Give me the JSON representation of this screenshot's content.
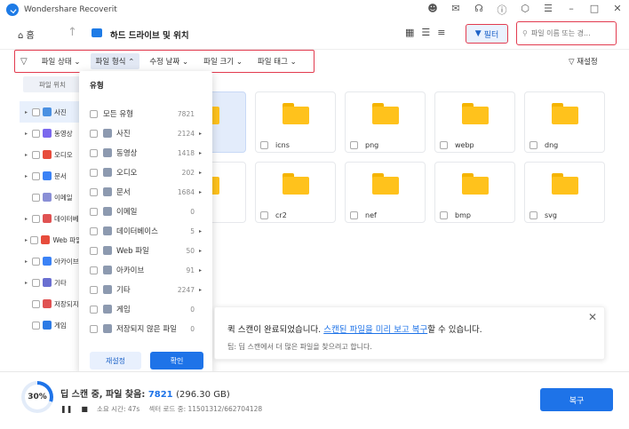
{
  "app": {
    "title": "Wondershare Recoverit"
  },
  "titlebar_icons": [
    "user-icon",
    "mail-icon",
    "headset-icon",
    "info-icon",
    "box-icon",
    "menu-icon",
    "minimize-icon",
    "maximize-icon",
    "close-icon"
  ],
  "nav": {
    "home": "홈",
    "drive_title": "하드 드라이브 및 위치",
    "filter_label": "필터",
    "search_placeholder": "파일 이름 또는 경..."
  },
  "filterbar": {
    "items": [
      "파일 상태",
      "파일 형식",
      "수정 날짜",
      "파일 크기",
      "파일 태그"
    ],
    "active_index": 1,
    "reset_label": "재설정"
  },
  "sidebar": {
    "header": "파일 위치",
    "items": [
      {
        "label": "사진",
        "color": "#4a90e2",
        "selected": true
      },
      {
        "label": "동영상",
        "color": "#7b68ee"
      },
      {
        "label": "오디오",
        "color": "#e74c3c"
      },
      {
        "label": "문서",
        "color": "#3b82f6"
      },
      {
        "label": "이메일",
        "color": "#8a8fd6"
      },
      {
        "label": "데이터베",
        "color": "#e05252"
      },
      {
        "label": "Web 파일",
        "color": "#e74c3c"
      },
      {
        "label": "아카이브",
        "color": "#3b82f6"
      },
      {
        "label": "기타",
        "color": "#6a6fd1"
      },
      {
        "label": "저장되지",
        "color": "#e05252"
      },
      {
        "label": "게임",
        "color": "#2d7be5"
      }
    ]
  },
  "dropdown": {
    "title": "유형",
    "rows": [
      {
        "label": "모든 유형",
        "count": "7821"
      },
      {
        "label": "사진",
        "count": "2124"
      },
      {
        "label": "동영상",
        "count": "1418"
      },
      {
        "label": "오디오",
        "count": "202"
      },
      {
        "label": "문서",
        "count": "1684"
      },
      {
        "label": "이메일",
        "count": "0"
      },
      {
        "label": "데이터베이스",
        "count": "5"
      },
      {
        "label": "Web 파일",
        "count": "50"
      },
      {
        "label": "아카이브",
        "count": "91"
      },
      {
        "label": "기타",
        "count": "2247"
      },
      {
        "label": "게임",
        "count": "0"
      },
      {
        "label": "저장되지 않은 파일",
        "count": "0"
      }
    ],
    "reset": "재설정",
    "ok": "확인"
  },
  "files": [
    {
      "name": "",
      "selected": true
    },
    {
      "name": "icns"
    },
    {
      "name": "png"
    },
    {
      "name": "webp"
    },
    {
      "name": "dng"
    },
    {
      "name": ""
    },
    {
      "name": "cr2"
    },
    {
      "name": "nef"
    },
    {
      "name": "bmp"
    },
    {
      "name": "svg"
    }
  ],
  "notification": {
    "prefix": "퀵 스캔이 완료되었습니다. ",
    "link": "스캔된 파일을 미리 보고 복구",
    "suffix": "할 수 있습니다.",
    "tip": "팁: 딥 스캔에서 더 많은 파일을 찾으려고 합니다."
  },
  "footer": {
    "progress": "30%",
    "progress_fraction": 0.3,
    "status_prefix": "딥 스캔 중, 파일 찾음: ",
    "found_count": "7821",
    "found_size": "(296.30 GB)",
    "elapsed": "소요 시간: 47s",
    "sectors": "섹터 로드 중: 11501312/662704128",
    "recover_label": "복구"
  }
}
